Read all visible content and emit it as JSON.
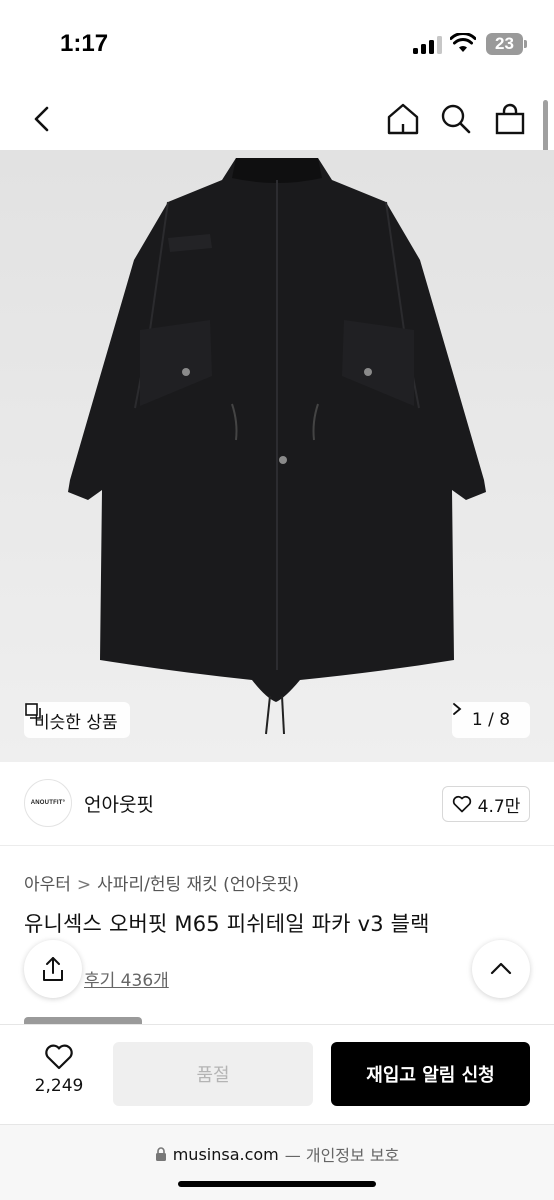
{
  "status_bar": {
    "time": "1:17",
    "battery": "23"
  },
  "nav": {
    "back_icon": "chevron-left-icon",
    "home_icon": "home-icon",
    "search_icon": "search-icon",
    "bag_icon": "shopping-bag-icon"
  },
  "gallery": {
    "similar_label": "비슷한 상품",
    "counter": "1 / 8"
  },
  "brand": {
    "logo_text": "ANOUTFIT°",
    "name": "언아웃핏",
    "likes": "4.7만"
  },
  "product": {
    "breadcrumb": [
      "아우터",
      "사파리/헌팅 재킷 (언아웃핏)"
    ],
    "title": "유니섹스 오버핏 M65 피쉬테일 파카 v3 블랙",
    "review_link": "후기 436개"
  },
  "action_bar": {
    "wish_count": "2,249",
    "soldout_label": "품절",
    "restock_label": "재입고 알림 신청"
  },
  "browser": {
    "domain": "musinsa.com",
    "suffix": "— 개인정보 보호"
  },
  "colors": {
    "primary_button": "#000000",
    "disabled_button": "#efefef",
    "image_bg": "#e8e8e8"
  }
}
